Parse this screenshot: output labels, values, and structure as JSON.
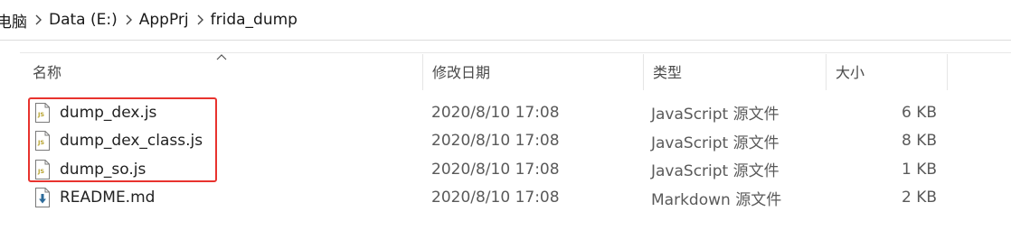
{
  "breadcrumb": {
    "items": [
      {
        "label": "电脑"
      },
      {
        "label": "Data (E:)"
      },
      {
        "label": "AppPrj"
      },
      {
        "label": "frida_dump"
      }
    ],
    "separator_icon": "chevron-right-icon"
  },
  "columns": {
    "name": "名称",
    "date": "修改日期",
    "type": "类型",
    "size": "大小",
    "sort_indicator_icon": "chevron-up-icon"
  },
  "files": [
    {
      "name": "dump_dex.js",
      "date": "2020/8/10 17:08",
      "type": "JavaScript 源文件",
      "size": "6 KB",
      "icon": "js-file-icon"
    },
    {
      "name": "dump_dex_class.js",
      "date": "2020/8/10 17:08",
      "type": "JavaScript 源文件",
      "size": "8 KB",
      "icon": "js-file-icon"
    },
    {
      "name": "dump_so.js",
      "date": "2020/8/10 17:08",
      "type": "JavaScript 源文件",
      "size": "1 KB",
      "icon": "js-file-icon"
    },
    {
      "name": "README.md",
      "date": "2020/8/10 17:08",
      "type": "Markdown 源文件",
      "size": "2 KB",
      "icon": "markdown-file-icon"
    }
  ],
  "colors": {
    "highlight": "#e8332e",
    "js_icon_label": "#b6a12a",
    "md_icon_arrow": "#2d6b9a"
  }
}
